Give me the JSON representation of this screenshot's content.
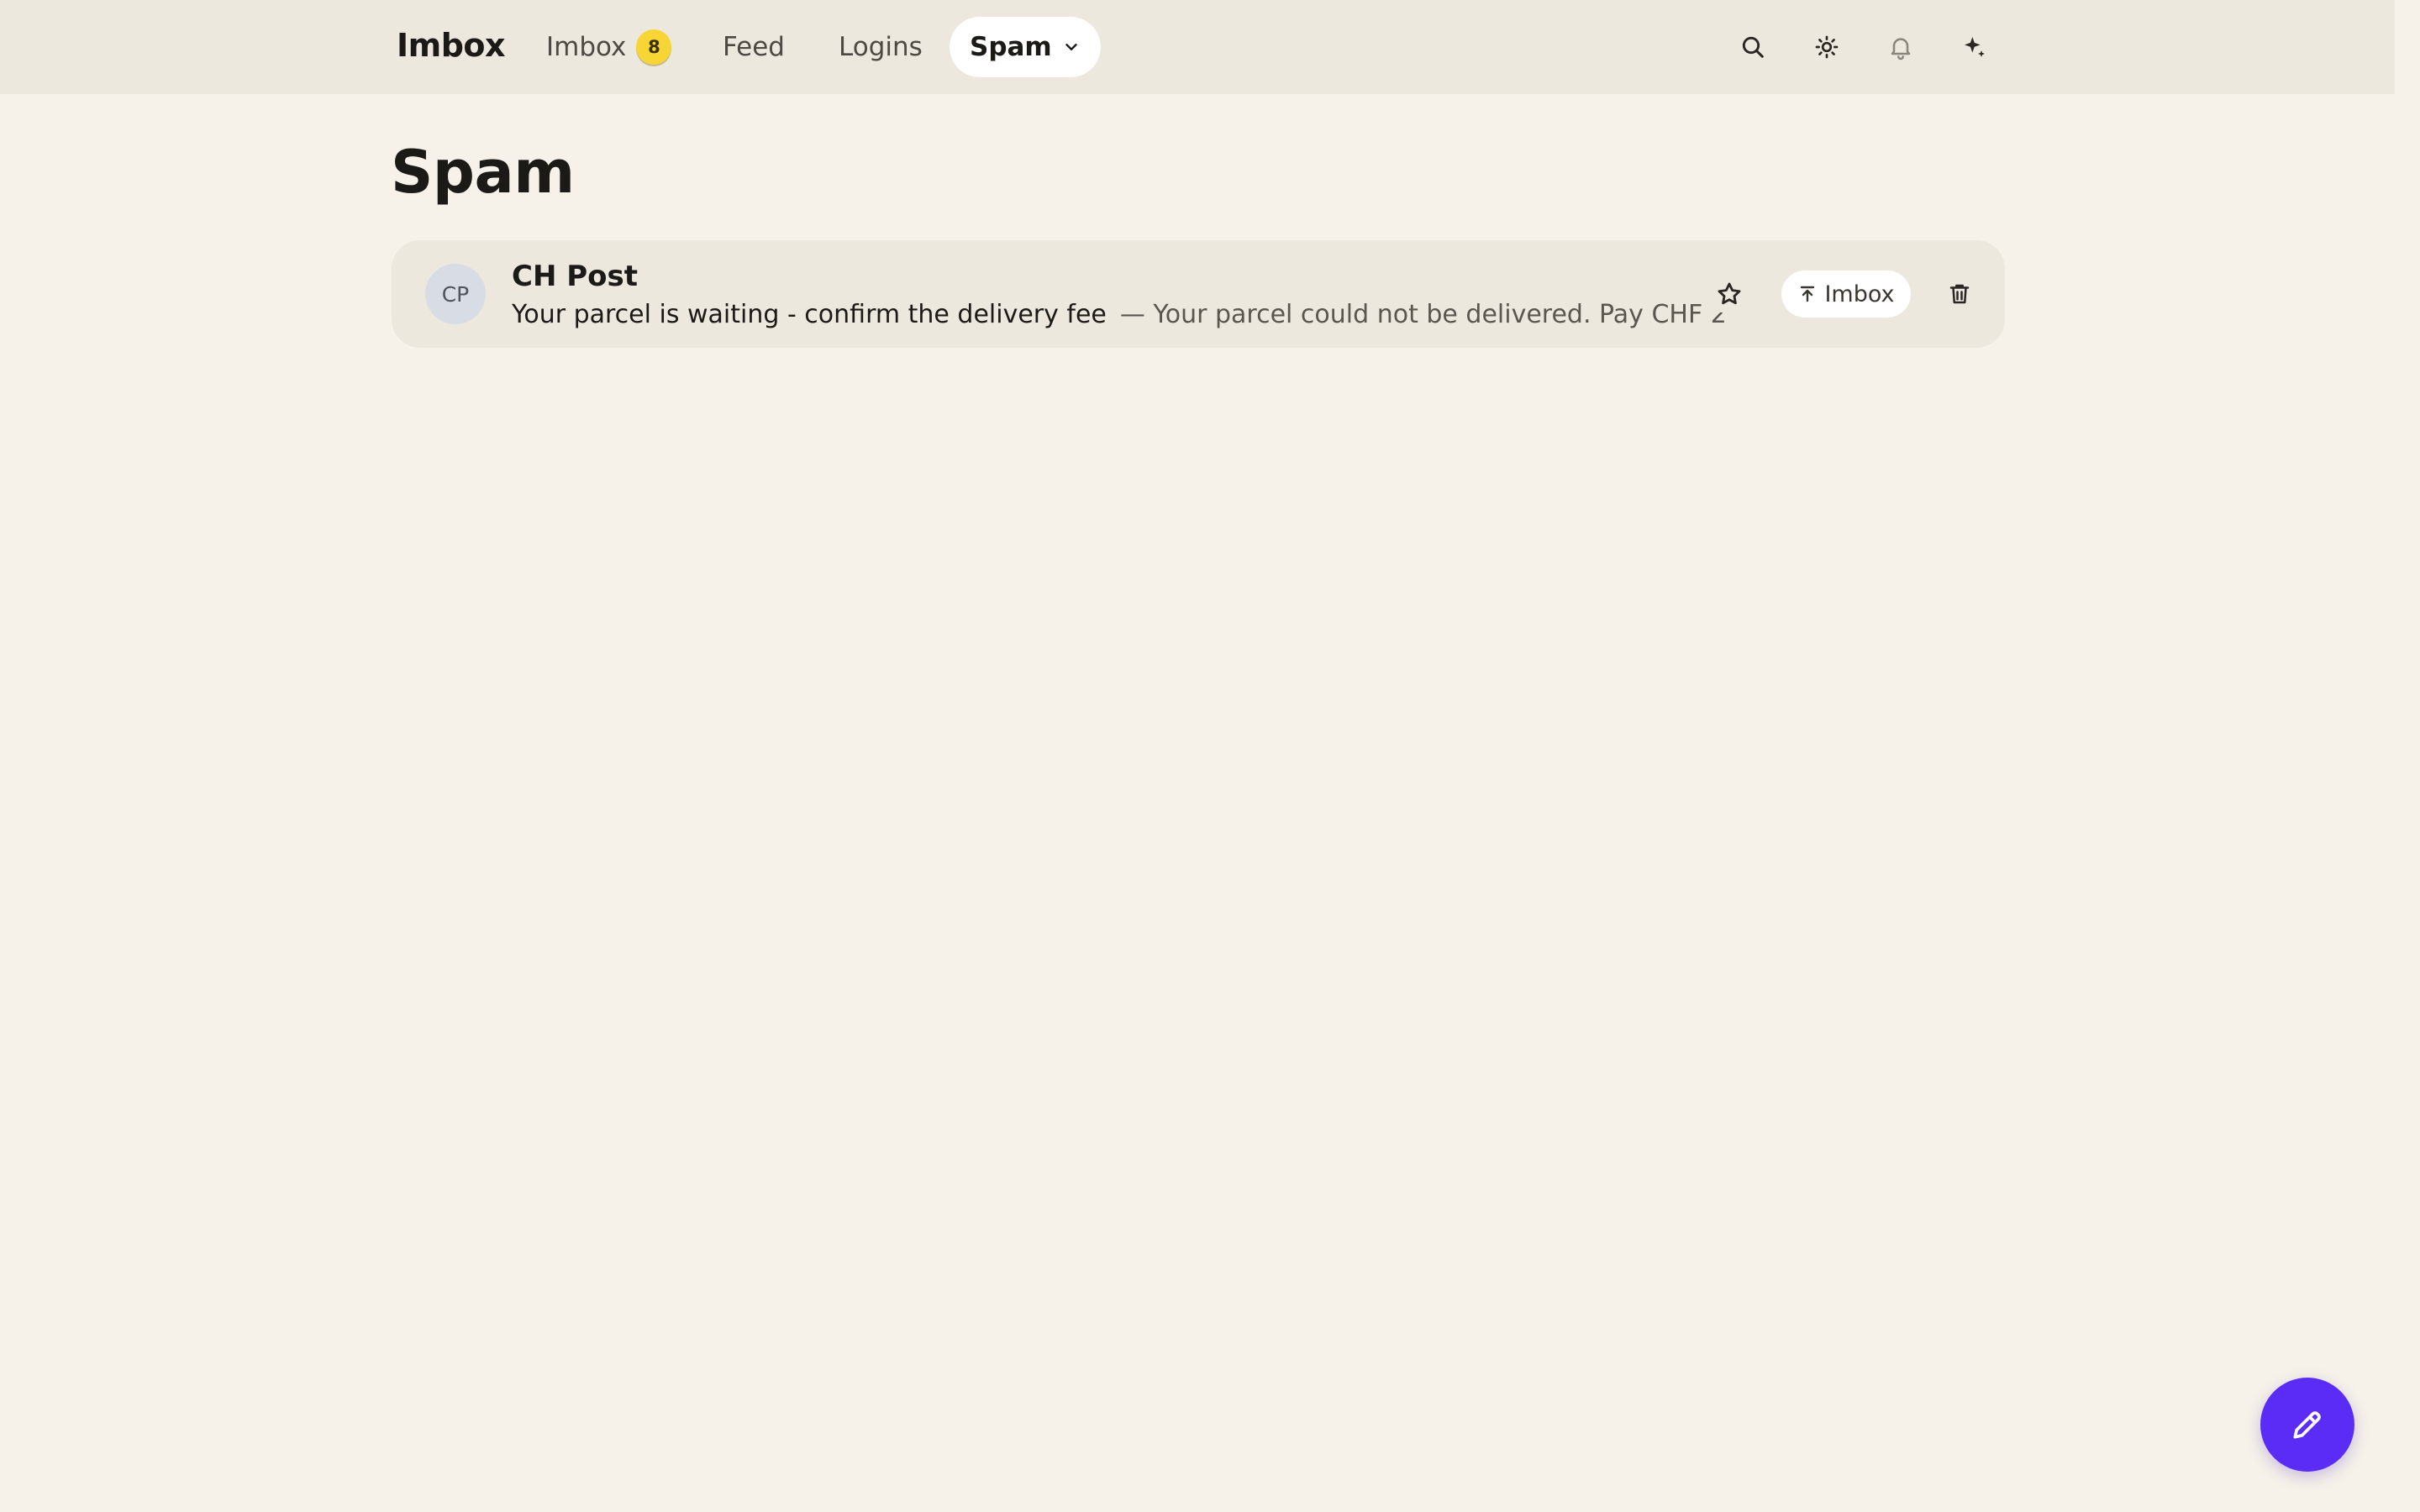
{
  "colors": {
    "background": "#f6f2e9",
    "topbar": "#ece8de",
    "row": "#ece8de",
    "badge": "#f7d534",
    "fab": "#5a2cf5",
    "active_pill": "#ffffff"
  },
  "header": {
    "brand": "Imbox",
    "nav": {
      "imbox": {
        "label": "Imbox",
        "badge": "8"
      },
      "feed": {
        "label": "Feed"
      },
      "logins": {
        "label": "Logins"
      },
      "spam": {
        "label": "Spam",
        "active": true
      }
    },
    "icons": [
      "search-icon",
      "theme-sun-icon",
      "bell-icon",
      "sparkle-icon"
    ]
  },
  "page": {
    "title": "Spam"
  },
  "messages": [
    {
      "avatar_initials": "CP",
      "sender": "CH Post",
      "subject": "Your parcel is waiting - confirm the delivery fee",
      "snippet": "— Your parcel could not be delivered. Pay CHF 2",
      "actions": {
        "move_label": "Imbox"
      }
    }
  ]
}
